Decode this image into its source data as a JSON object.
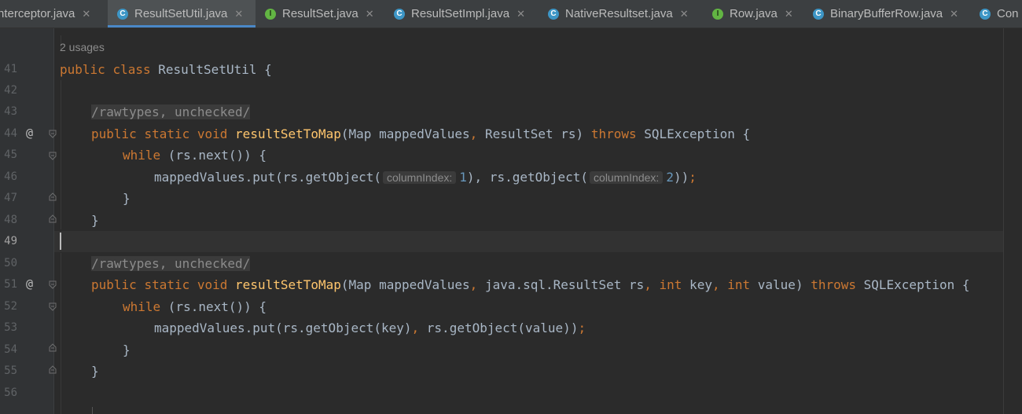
{
  "tabs": [
    {
      "icon": "c",
      "name": "nterceptor.java",
      "active": false
    },
    {
      "icon": "c",
      "name": "ResultSetUtil.java",
      "active": true
    },
    {
      "icon": "i",
      "name": "ResultSet.java",
      "active": false
    },
    {
      "icon": "c",
      "name": "ResultSetImpl.java",
      "active": false
    },
    {
      "icon": "c",
      "name": "NativeResultset.java",
      "active": false
    },
    {
      "icon": "i",
      "name": "Row.java",
      "active": false
    },
    {
      "icon": "c",
      "name": "BinaryBufferRow.java",
      "active": false
    },
    {
      "icon": "c",
      "name": "Con",
      "active": false
    }
  ],
  "editor": {
    "usages": "2 usages",
    "line_numbers": [
      "41",
      "42",
      "43",
      "44",
      "45",
      "46",
      "47",
      "48",
      "49",
      "50",
      "51",
      "52",
      "53",
      "54",
      "55",
      "56"
    ],
    "current_line": "49",
    "l41": {
      "kw1": "public",
      "kw2": "class",
      "rest": "ResultSetUtil {"
    },
    "l43": {
      "annotation": "/rawtypes, unchecked/"
    },
    "l44": {
      "kw1": "public",
      "kw2": "static",
      "kw3": "void",
      "fn": "resultSetToMap",
      "p1": "(Map mappedValues",
      "comma1": ",",
      "p2": " ResultSet rs) ",
      "throws": "throws",
      "p3": " SQLException {"
    },
    "l45": {
      "kw": "while",
      "rest": " (rs.next()) {"
    },
    "l46": {
      "a": "mappedValues.put(rs.getObject(",
      "hint1": "columnIndex:",
      "n1": "1",
      "b": "),",
      "c": " rs.getObject(",
      "hint2": "columnIndex:",
      "n2": "2",
      "d": "))",
      "semi": ";"
    },
    "l47": "}",
    "l48": "}",
    "l50": {
      "annotation": "/rawtypes, unchecked/"
    },
    "l51": {
      "kw1": "public",
      "kw2": "static",
      "kw3": "void",
      "fn": "resultSetToMap",
      "p1": "(Map mappedValues",
      "comma1": ",",
      "p2": " java.sql.ResultSet rs",
      "comma2": ",",
      "int1": "int",
      "p3": " key",
      "comma3": ",",
      "int2": "int",
      "p4": " value) ",
      "throws": "throws",
      "p5": " SQLException {"
    },
    "l52": {
      "kw": "while",
      "rest": " (rs.next()) {"
    },
    "l53": {
      "a": "mappedValues.put(rs.getObject(key)",
      "comma": ",",
      "b": " rs.getObject(value))",
      "semi": ";"
    },
    "l54": "}",
    "l55": "}"
  },
  "colors": {
    "keyword": "#cc7832",
    "function": "#ffc66d",
    "number": "#6897bb",
    "text": "#a9b7c6",
    "background": "#2b2b2b",
    "tab_active_underline": "#4a88c7"
  }
}
